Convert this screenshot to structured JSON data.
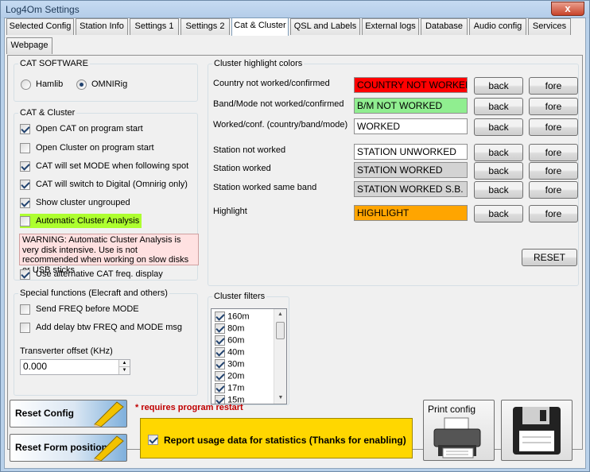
{
  "window": {
    "title": "Log4Om Settings",
    "close_label": "x"
  },
  "tabs": [
    "Selected Config",
    "Station Info",
    "Settings 1",
    "Settings 2",
    "Cat & Cluster",
    "QSL and Labels",
    "External logs",
    "Database",
    "Audio config",
    "Services",
    "Webpage"
  ],
  "cat_software": {
    "title": "CAT SOFTWARE",
    "options": [
      "Hamlib",
      "OMNIRig"
    ],
    "selected": "OMNIRig"
  },
  "cat_cluster": {
    "title": "CAT & Cluster",
    "items": [
      {
        "label": "Open CAT on program start",
        "checked": true
      },
      {
        "label": "Open Cluster on program start",
        "checked": false
      },
      {
        "label": "CAT will set MODE when following spot",
        "checked": true
      },
      {
        "label": "CAT will switch to Digital (Omnirig only)",
        "checked": true
      },
      {
        "label": "Show cluster ungrouped",
        "checked": true
      },
      {
        "label": "Automatic Cluster Analysis",
        "checked": false
      }
    ],
    "warning": "WARNING: Automatic Cluster Analysis is very disk intensive. Use is not recommended when working on slow disks or USB sticks",
    "alt_cat": {
      "label": "Use alternative CAT freq. display",
      "checked": true
    }
  },
  "special": {
    "title": "Special functions (Elecraft and others)",
    "items": [
      {
        "label": "Send FREQ before MODE",
        "checked": false
      },
      {
        "label": "Add delay btw FREQ and MODE msg",
        "checked": false
      }
    ],
    "transverter_label": "Transverter offset (KHz)",
    "transverter_value": "0.000"
  },
  "highlight": {
    "title": "Cluster highlight colors",
    "back_label": "back",
    "fore_label": "fore",
    "reset_label": "RESET",
    "rows": [
      {
        "label": "Country not worked/confirmed",
        "text": "COUNTRY NOT WORKED",
        "bg": "#ff0000",
        "fg": "#000000"
      },
      {
        "label": "Band/Mode not worked/confirmed",
        "text": "B/M NOT WORKED",
        "bg": "#90ee90",
        "fg": "#000000"
      },
      {
        "label": "Worked/conf. (country/band/mode)",
        "text": "WORKED",
        "bg": "#ffffff",
        "fg": "#000000"
      },
      {
        "label": "Station not worked",
        "text": "STATION UNWORKED",
        "bg": "#ffffff",
        "fg": "#000000"
      },
      {
        "label": "Station worked",
        "text": "STATION WORKED",
        "bg": "#d3d3d3",
        "fg": "#000000"
      },
      {
        "label": "Station worked same band",
        "text": "STATION WORKED S.B.",
        "bg": "#d3d3d3",
        "fg": "#000000"
      },
      {
        "label": "Highlight",
        "text": "HIGHLIGHT",
        "bg": "#ffa500",
        "fg": "#000000"
      }
    ]
  },
  "filters": {
    "title": "Cluster filters",
    "bands": [
      "160m",
      "80m",
      "60m",
      "40m",
      "30m",
      "20m",
      "17m",
      "15m"
    ]
  },
  "footer": {
    "reset_config": "Reset Config",
    "reset_form": "Reset Form positions",
    "restart_note": "* requires program restart",
    "report_label": "Report usage data for statistics (Thanks for enabling)",
    "report_checked": true,
    "print_label": "Print config",
    "save_icon": "floppy-disk-icon"
  },
  "colors": {
    "accent_yellow": "#ffd700",
    "note_red": "#c00000"
  }
}
